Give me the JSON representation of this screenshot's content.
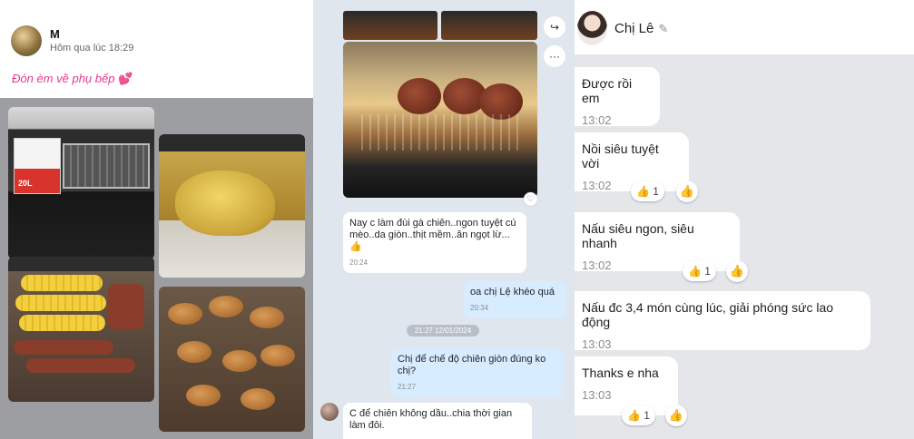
{
  "post": {
    "author": "M",
    "time": "Hôm qua lúc 18:29",
    "caption": "Đón èm về phụ bếp",
    "caption_emoji": "💕",
    "product_label": "20L"
  },
  "chat": {
    "messages": [
      {
        "side": "in",
        "text": "Nay c làm đùi gà chiên..ngon tuyệt cú mèo..da giòn..thịt mềm..ăn ngọt lừ...👍",
        "time": "20:24"
      },
      {
        "side": "out",
        "text": "oa chị Lệ khéo quá",
        "time": "20:34"
      },
      {
        "side": "out",
        "text": "Chị để chế độ chiên giòn đúng ko chị?",
        "time": "21:27"
      },
      {
        "side": "in",
        "text": "C để chiên không dầu..chia thời gian làm đôi.",
        "time": ""
      }
    ],
    "date_chip": "21:27 12/01/2024",
    "share_icon": "↪",
    "more_icon": "···",
    "heart_icon": "♡"
  },
  "contact": {
    "name": "Chị Lê",
    "edit_icon": "✎",
    "messages": [
      {
        "text": "Được rồi em",
        "time": "13:02"
      },
      {
        "text": "Nồi siêu tuyệt vời",
        "time": "13:02",
        "likes": "1"
      },
      {
        "text": "Nấu siêu ngon, siêu nhanh",
        "time": "13:02",
        "likes": "1"
      },
      {
        "text": "Nấu đc 3,4 món cùng lúc, giải phóng sức lao động",
        "time": "13:03"
      },
      {
        "text": "Thanks e nha",
        "time": "13:03",
        "likes": "1"
      }
    ],
    "like_icon": "👍"
  },
  "colors": {
    "caption": "#e4398f",
    "accent": "#1877f2",
    "outgoing": "#d8ecff"
  }
}
